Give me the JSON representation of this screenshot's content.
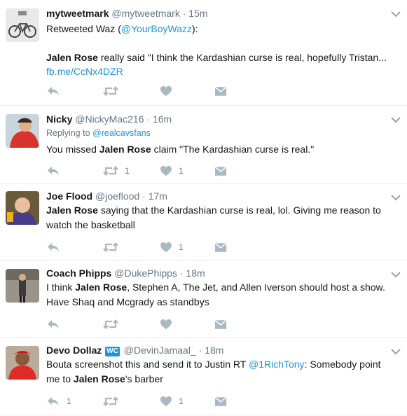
{
  "tweets": [
    {
      "name": "mytweetmark",
      "handle": "@mytweetmark",
      "dot": "·",
      "time": "15m",
      "retweet_prefix": "Retweeted Waz (",
      "retweet_handle": "@YourBoyWazz",
      "retweet_suffix": "):",
      "bold": "Jalen Rose",
      "text_after": " really said \"I think the Kardashian curse is real, hopefully Tristan...",
      "link": "fb.me/CcNx4DZR",
      "reply_count": "",
      "retweet_count": "",
      "like_count": ""
    },
    {
      "name": "Nicky",
      "handle": "@NickyMac216",
      "dot": "·",
      "time": "16m",
      "replying_prefix": "Replying to ",
      "replying_handle": "@realcavsfans",
      "text_before": "You missed ",
      "bold": "Jalen Rose",
      "text_after": " claim \"The Kardashian curse is real.\"",
      "reply_count": "",
      "retweet_count": "1",
      "like_count": "1"
    },
    {
      "name": "Joe Flood",
      "handle": "@joeflood",
      "dot": "·",
      "time": "17m",
      "bold": "Jalen Rose",
      "text_after": " saying that the Kardashian curse is real, lol. Giving me reason to watch the basketball",
      "reply_count": "",
      "retweet_count": "",
      "like_count": "1"
    },
    {
      "name": "Coach Phipps",
      "handle": "@DukePhipps",
      "dot": "·",
      "time": "18m",
      "text_before": "I think ",
      "bold": "Jalen Rose",
      "text_after": ", Stephen A, The Jet, and Allen Iverson should host a show. Have Shaq and Mcgrady as standbys",
      "reply_count": "",
      "retweet_count": "",
      "like_count": ""
    },
    {
      "name": "Devo Dollaz",
      "badge": "WC",
      "handle": "@DevinJamaal_",
      "dot": "·",
      "time": "18m",
      "text_before": "Bouta screenshot this and send it to Justin RT ",
      "mention": "@1RichTony",
      "text_mid": ": Somebody point me to ",
      "bold": "Jalen Rose",
      "text_after": "'s barber",
      "reply_count": "1",
      "retweet_count": "",
      "like_count": "1"
    }
  ],
  "colors": {
    "link": "#1b95e0",
    "action_icon": "#aab8c2",
    "meta": "#657786",
    "divider": "#e6ecf0"
  },
  "icons": [
    "reply-icon",
    "retweet-icon",
    "heart-icon",
    "direct-message-icon",
    "chevron-down-icon"
  ]
}
